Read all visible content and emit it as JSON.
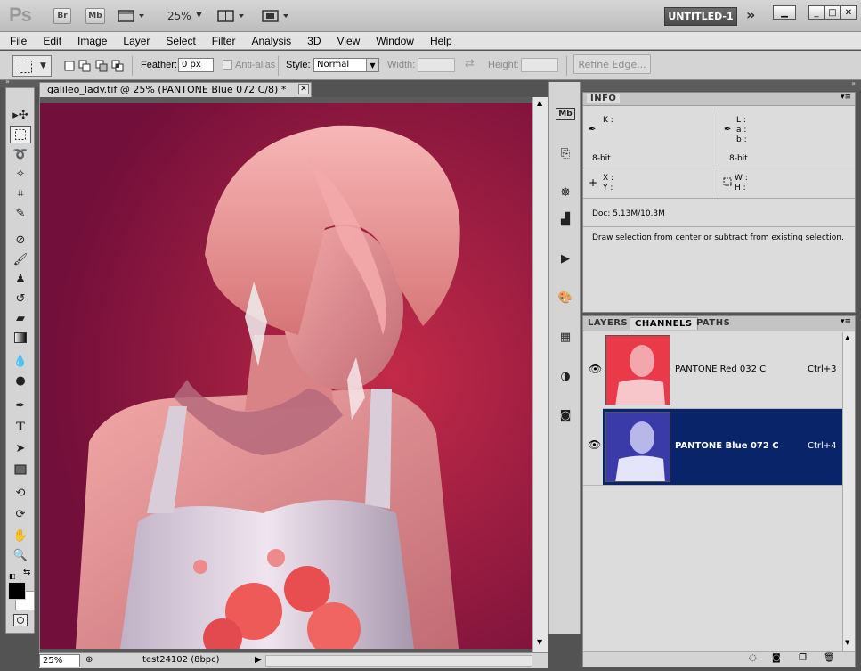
{
  "appbar": {
    "logo": "Ps",
    "bridge_label": "Br",
    "minibridge_label": "Mb",
    "zoom": "25%",
    "workspace": "UNTITLED-1",
    "more": "»"
  },
  "menu": [
    "File",
    "Edit",
    "Image",
    "Layer",
    "Select",
    "Filter",
    "Analysis",
    "3D",
    "View",
    "Window",
    "Help"
  ],
  "options": {
    "feather_label": "Feather:",
    "feather_value": "0 px",
    "antialias_label": "Anti-alias",
    "style_label": "Style:",
    "style_value": "Normal",
    "width_label": "Width:",
    "height_label": "Height:",
    "refine_label": "Refine Edge..."
  },
  "document": {
    "tab_title": "galileo_lady.tif @ 25% (PANTONE Blue 072 C/8) *",
    "status_zoom": "25%",
    "status_info": "test24102 (8bpc)"
  },
  "info_panel": {
    "tab": "INFO",
    "k_label": "K :",
    "l_label": "L :",
    "a_label": "a :",
    "b_label": "b :",
    "bit_left": "8-bit",
    "bit_right": "8-bit",
    "x_label": "X :",
    "y_label": "Y :",
    "w_label": "W :",
    "h_label": "H :",
    "doc": "Doc: 5.13M/10.3M",
    "hint": "Draw selection from center or subtract from existing selection."
  },
  "channels_panel": {
    "tabs": [
      "LAYERS",
      "CHANNELS",
      "PATHS"
    ],
    "active_tab": "CHANNELS",
    "channels": [
      {
        "name": "PANTONE Red 032 C",
        "shortcut": "Ctrl+3",
        "color": "#e8424e"
      },
      {
        "name": "PANTONE Blue 072 C",
        "shortcut": "Ctrl+4",
        "color": "#0b2a7a"
      }
    ]
  },
  "colors": {
    "image_bg": "#8d1640",
    "selection_highlight": "#0a246a",
    "ui_panel": "#d4d4d4"
  }
}
